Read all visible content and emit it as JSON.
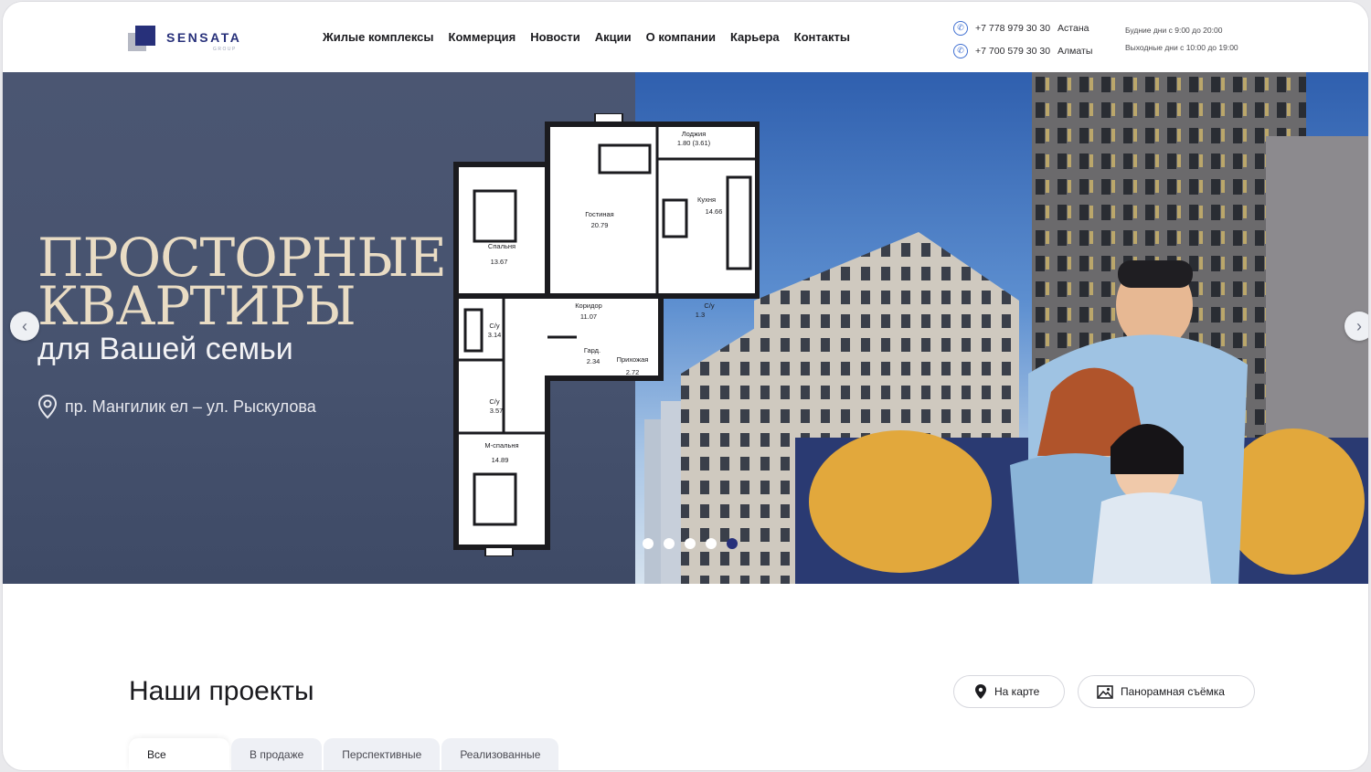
{
  "brand": {
    "name": "SENSATA",
    "sub": "GROUP",
    "accent": "#27307a"
  },
  "nav": {
    "items": [
      {
        "label": "Жилые комплексы"
      },
      {
        "label": "Коммерция"
      },
      {
        "label": "Новости"
      },
      {
        "label": "Акции"
      },
      {
        "label": "О компании"
      },
      {
        "label": "Карьера"
      },
      {
        "label": "Контакты"
      }
    ]
  },
  "contacts": {
    "phones": [
      {
        "number": "+7 778 979 30 30",
        "city": "Астана"
      },
      {
        "number": "+7 700 579 30 30",
        "city": "Алматы"
      }
    ],
    "hours": [
      "Будние дни с 9:00 до 20:00",
      "Выходные дни с 10:00 до 19:00"
    ]
  },
  "hero": {
    "title_line1": "ПРОСТОРНЫЕ",
    "title_line2": "КВАРТИРЫ",
    "subtitle": "для Вашей семьи",
    "address": "пр. Мангилик ел – ул. Рыскулова",
    "floorplan": {
      "rooms": [
        {
          "name": "Лоджия",
          "area": "1.80 (3.61)"
        },
        {
          "name": "Гостиная",
          "area": "20.79"
        },
        {
          "name": "Кухня",
          "area": "14.66"
        },
        {
          "name": "Спальня",
          "area": "13.67"
        },
        {
          "name": "Коридор",
          "area": "11.07"
        },
        {
          "name": "С/у",
          "area": "1.3"
        },
        {
          "name": "С/у",
          "area": "3.14"
        },
        {
          "name": "Гард.",
          "area": "2.34"
        },
        {
          "name": "Прихожая",
          "area": "2.72"
        },
        {
          "name": "С/у",
          "area": "3.57"
        },
        {
          "name": "М-спальня",
          "area": "14.89"
        }
      ]
    },
    "slides": {
      "total": 5,
      "active": 5
    }
  },
  "projects": {
    "title": "Наши проекты",
    "map_button": "На карте",
    "pano_button": "Панорамная съёмка",
    "tabs": [
      "Все",
      "В продаже",
      "Перспективные",
      "Реализованные"
    ]
  }
}
